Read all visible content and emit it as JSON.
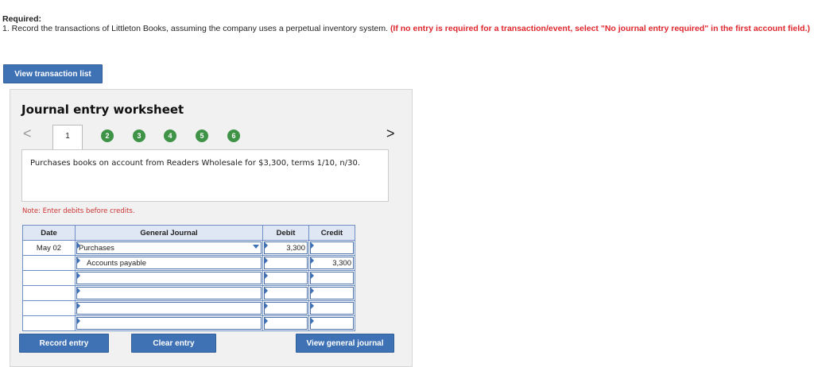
{
  "header": {
    "required_label": "Required:",
    "instruction": "1. Record the transactions of Littleton Books, assuming the company uses a perpetual inventory system.",
    "instruction_note": "(If no entry is required for a transaction/event, select \"No journal entry required\" in the first account field.)"
  },
  "buttons": {
    "view_transaction_list": "View transaction list",
    "record_entry": "Record entry",
    "clear_entry": "Clear entry",
    "view_general_journal": "View general journal"
  },
  "worksheet": {
    "title": "Journal entry worksheet",
    "nav_prev": "<",
    "nav_next": ">",
    "tabs": [
      "1",
      "2",
      "3",
      "4",
      "5",
      "6"
    ],
    "active_tab": "1",
    "description": "Purchases books on account from Readers Wholesale for $3,300, terms 1/10, n/30.",
    "note": "Note: Enter debits before credits."
  },
  "journal": {
    "columns": [
      "Date",
      "General Journal",
      "Debit",
      "Credit"
    ],
    "rows": [
      {
        "date": "May 02",
        "account": "Purchases",
        "debit": "3,300",
        "credit": ""
      },
      {
        "date": "",
        "account": "Accounts payable",
        "debit": "",
        "credit": "3,300"
      },
      {
        "date": "",
        "account": "",
        "debit": "",
        "credit": ""
      },
      {
        "date": "",
        "account": "",
        "debit": "",
        "credit": ""
      },
      {
        "date": "",
        "account": "",
        "debit": "",
        "credit": ""
      },
      {
        "date": "",
        "account": "",
        "debit": "",
        "credit": ""
      }
    ]
  },
  "colors": {
    "button_blue": "#3f72b5",
    "tab_green": "#3e9347",
    "required_red": "#e0262d"
  }
}
